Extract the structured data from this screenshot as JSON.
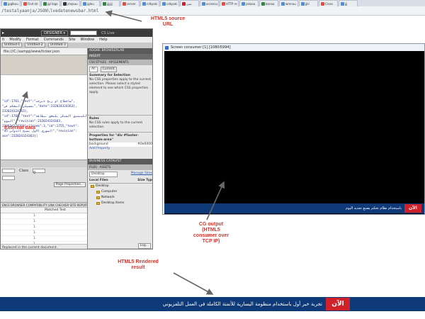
{
  "browser": {
    "tabs": [
      {
        "label": "jpglbuu",
        "color": "#4a90d9"
      },
      {
        "label": "Find str",
        "color": "#e94b3c"
      },
      {
        "label": "jgl logo",
        "color": "#2b8a3e"
      },
      {
        "label": "jmqsuu",
        "color": "#333333"
      },
      {
        "label": "jgleu",
        "color": "#4a90d9"
      },
      {
        "label": "jjjjjjj",
        "color": "#2b8a3e"
      },
      {
        "label": "server",
        "color": "#e94b3c"
      },
      {
        "label": "cdkyaki",
        "color": "#4a90d9"
      },
      {
        "label": "cdkyaki",
        "color": "#4a90d9"
      },
      {
        "label": "تعبئ",
        "color": "#d0202a"
      },
      {
        "label": "accessu",
        "color": "#4a90d9"
      },
      {
        "label": "HTTP re",
        "color": "#e94b3c"
      },
      {
        "label": "jakaaa",
        "color": "#4a90d9"
      },
      {
        "label": "bonaa",
        "color": "#2b8a3e"
      },
      {
        "label": "wmnuu",
        "color": "#4a90d9"
      },
      {
        "label": "jjkl",
        "color": "#4a90d9"
      },
      {
        "label": "Cross",
        "color": "#e94b3c"
      },
      {
        "label": "jjj",
        "color": "#4a90d9"
      }
    ],
    "url": "/testalyaanja/JSON\\lvedatenewsbar.html"
  },
  "annotations": {
    "source_url": "HTML5 source\nURL",
    "external_data": "External data",
    "cg_output": "CG output\n(HTML5\nconsumer over\nTCP IP)",
    "rendered_result": "HTML5 Rendered\nresult"
  },
  "dreamweaver": {
    "workspace": "DESIGNER ▾",
    "cslive": "CS Live",
    "menu": [
      "it",
      "Modify",
      "Format",
      "Commands",
      "Site",
      "Window",
      "Help"
    ],
    "doc_tabs": [
      "Untitled-1",
      "Untitled-2",
      "Untitled-3"
    ],
    "path": "file:///C:/xampp/www/ticker.json",
    "code_lines": [
      "\"id\":1761,\"text\":\"ساخطاغ او ريخ ةبرجت\",",
      "\"تفصيلي التحكم في\",\"date\":232024324363},",
      "232024324363},",
      "\"id\":1760,\"text\":\"للتنسيق الشبكي يلتحق ببطاقة\",",
      "\"اليوم\",\"revision\":232024324363,",
      "232024324363},{\"rank\":3,\"id\":1755,\"text\":",
      "\"السوري الاول يصبح الدولي 45\",\"revision\":",
      "ace\":232024324363}]"
    ],
    "props": {
      "row1_label": "Class",
      "row1_value": "0",
      "row2_label": "Page Properties..."
    },
    "results": {
      "header": "ENCE  BROWSER COMPATIBILITY  LINK CHECKER  SITE REPORTS  FTP LOG  SERVER DEBUG",
      "column": "Matched Text",
      "rows": [
        "1.",
        "1.",
        "1.",
        "1.",
        "1.",
        "1."
      ],
      "status": "Replaced in the current document."
    },
    "panels": {
      "browserlab": "ADOBE BROWSERLAB",
      "insert": "INSERT",
      "css_tabs": [
        "CSS STYLES",
        "AP ELEMENTS"
      ],
      "css_subtabs": [
        "All",
        "Current"
      ],
      "summary_title": "Summary for Selection",
      "summary_text": "No CSS properties apply to the current selection. Please select a styled element to see which CSS properties apply.",
      "rules_title": "Rules",
      "rules_text": "No CSS rules apply to the current selection.",
      "props_title": "Properties for \"div #footer-bottom-area\"",
      "props_row1": "background",
      "props_row1_val": "#0e0000",
      "props_row2": "Add Property",
      "catalyst": "BUSINESS CATALYST",
      "files_tabs": [
        "FILES",
        "ASSETS"
      ],
      "files_dropdown": "Desktop",
      "manage_sites": "Manage Sites",
      "local_files": "Local Files",
      "size_typ": "Size Typ",
      "tree": [
        "Desktop",
        "Computer",
        "Network",
        "Desktop items"
      ],
      "log": "Log..."
    }
  },
  "screen_consumer": {
    "title": "Screen consumer [1] [1080i5994]",
    "ticker_text": "باستخدام نظام تحكم يصنع تجديد اليوم",
    "ticker_badge": "الآن"
  },
  "bottom_ticker": {
    "badge": "الآن",
    "text": "تجربة خبر أول باستخدام منظومة اليسارية للأتمتة الكاملة في العمل التلفزيوني"
  },
  "colors": {
    "ticker_bg": "#0e3a7a",
    "badge_red": "#d0202a",
    "annotation_red": "#d9332b"
  }
}
